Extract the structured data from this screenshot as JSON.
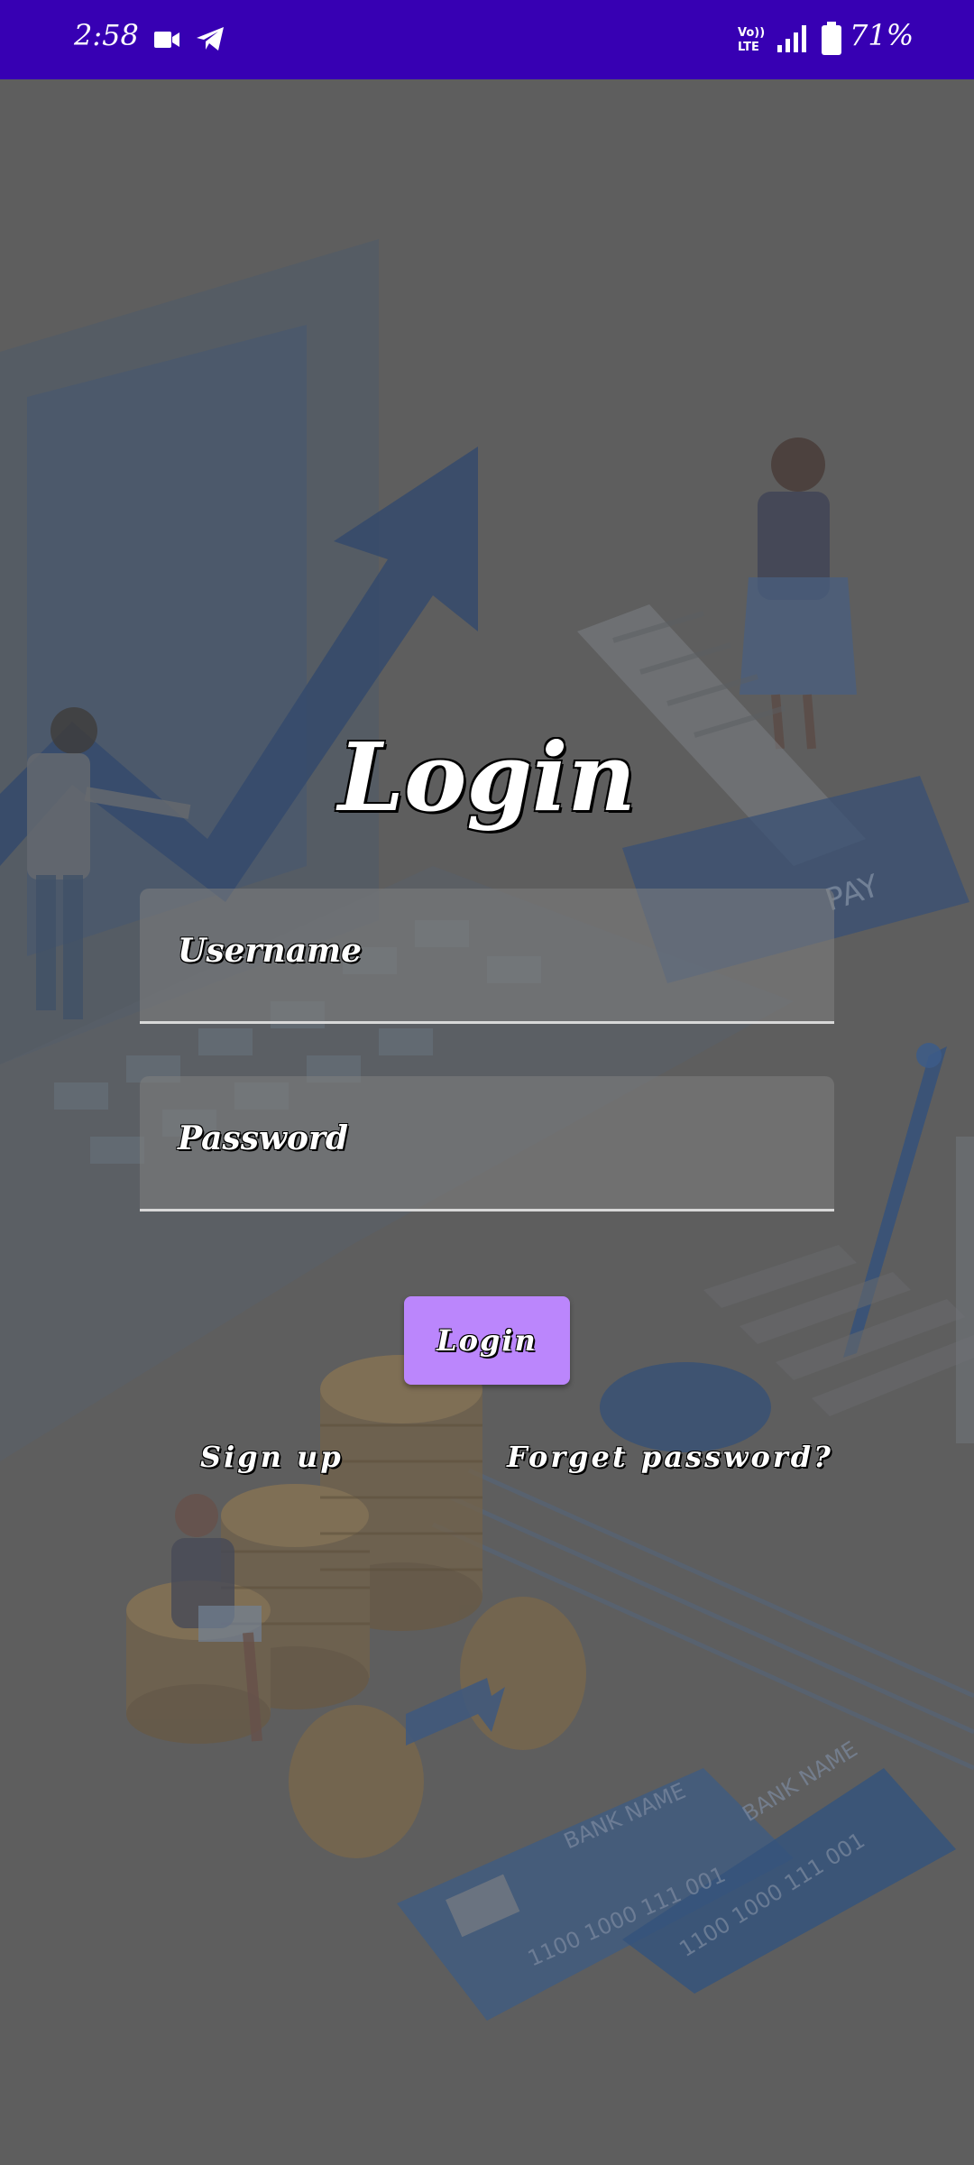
{
  "status_bar": {
    "time": "2:58",
    "network_label": "Vo)) LTE",
    "battery": "71%",
    "icons": [
      "video-camera-icon",
      "telegram-icon",
      "volte-icon",
      "signal-icon",
      "battery-icon"
    ]
  },
  "login": {
    "title": "Login",
    "username_placeholder": "Username",
    "password_placeholder": "Password",
    "login_button": "Login",
    "signup_link": "Sign up",
    "forgot_link": "Forget password?"
  },
  "background": {
    "labels": [
      "PAY",
      "BANK NAME",
      "1100 1000 111 001",
      "1100 1000 111 001",
      "BANK NAME"
    ]
  },
  "colors": {
    "status_bar": "#3700b3",
    "button": "#bb86fc",
    "overlay": "#5e5e5e"
  }
}
